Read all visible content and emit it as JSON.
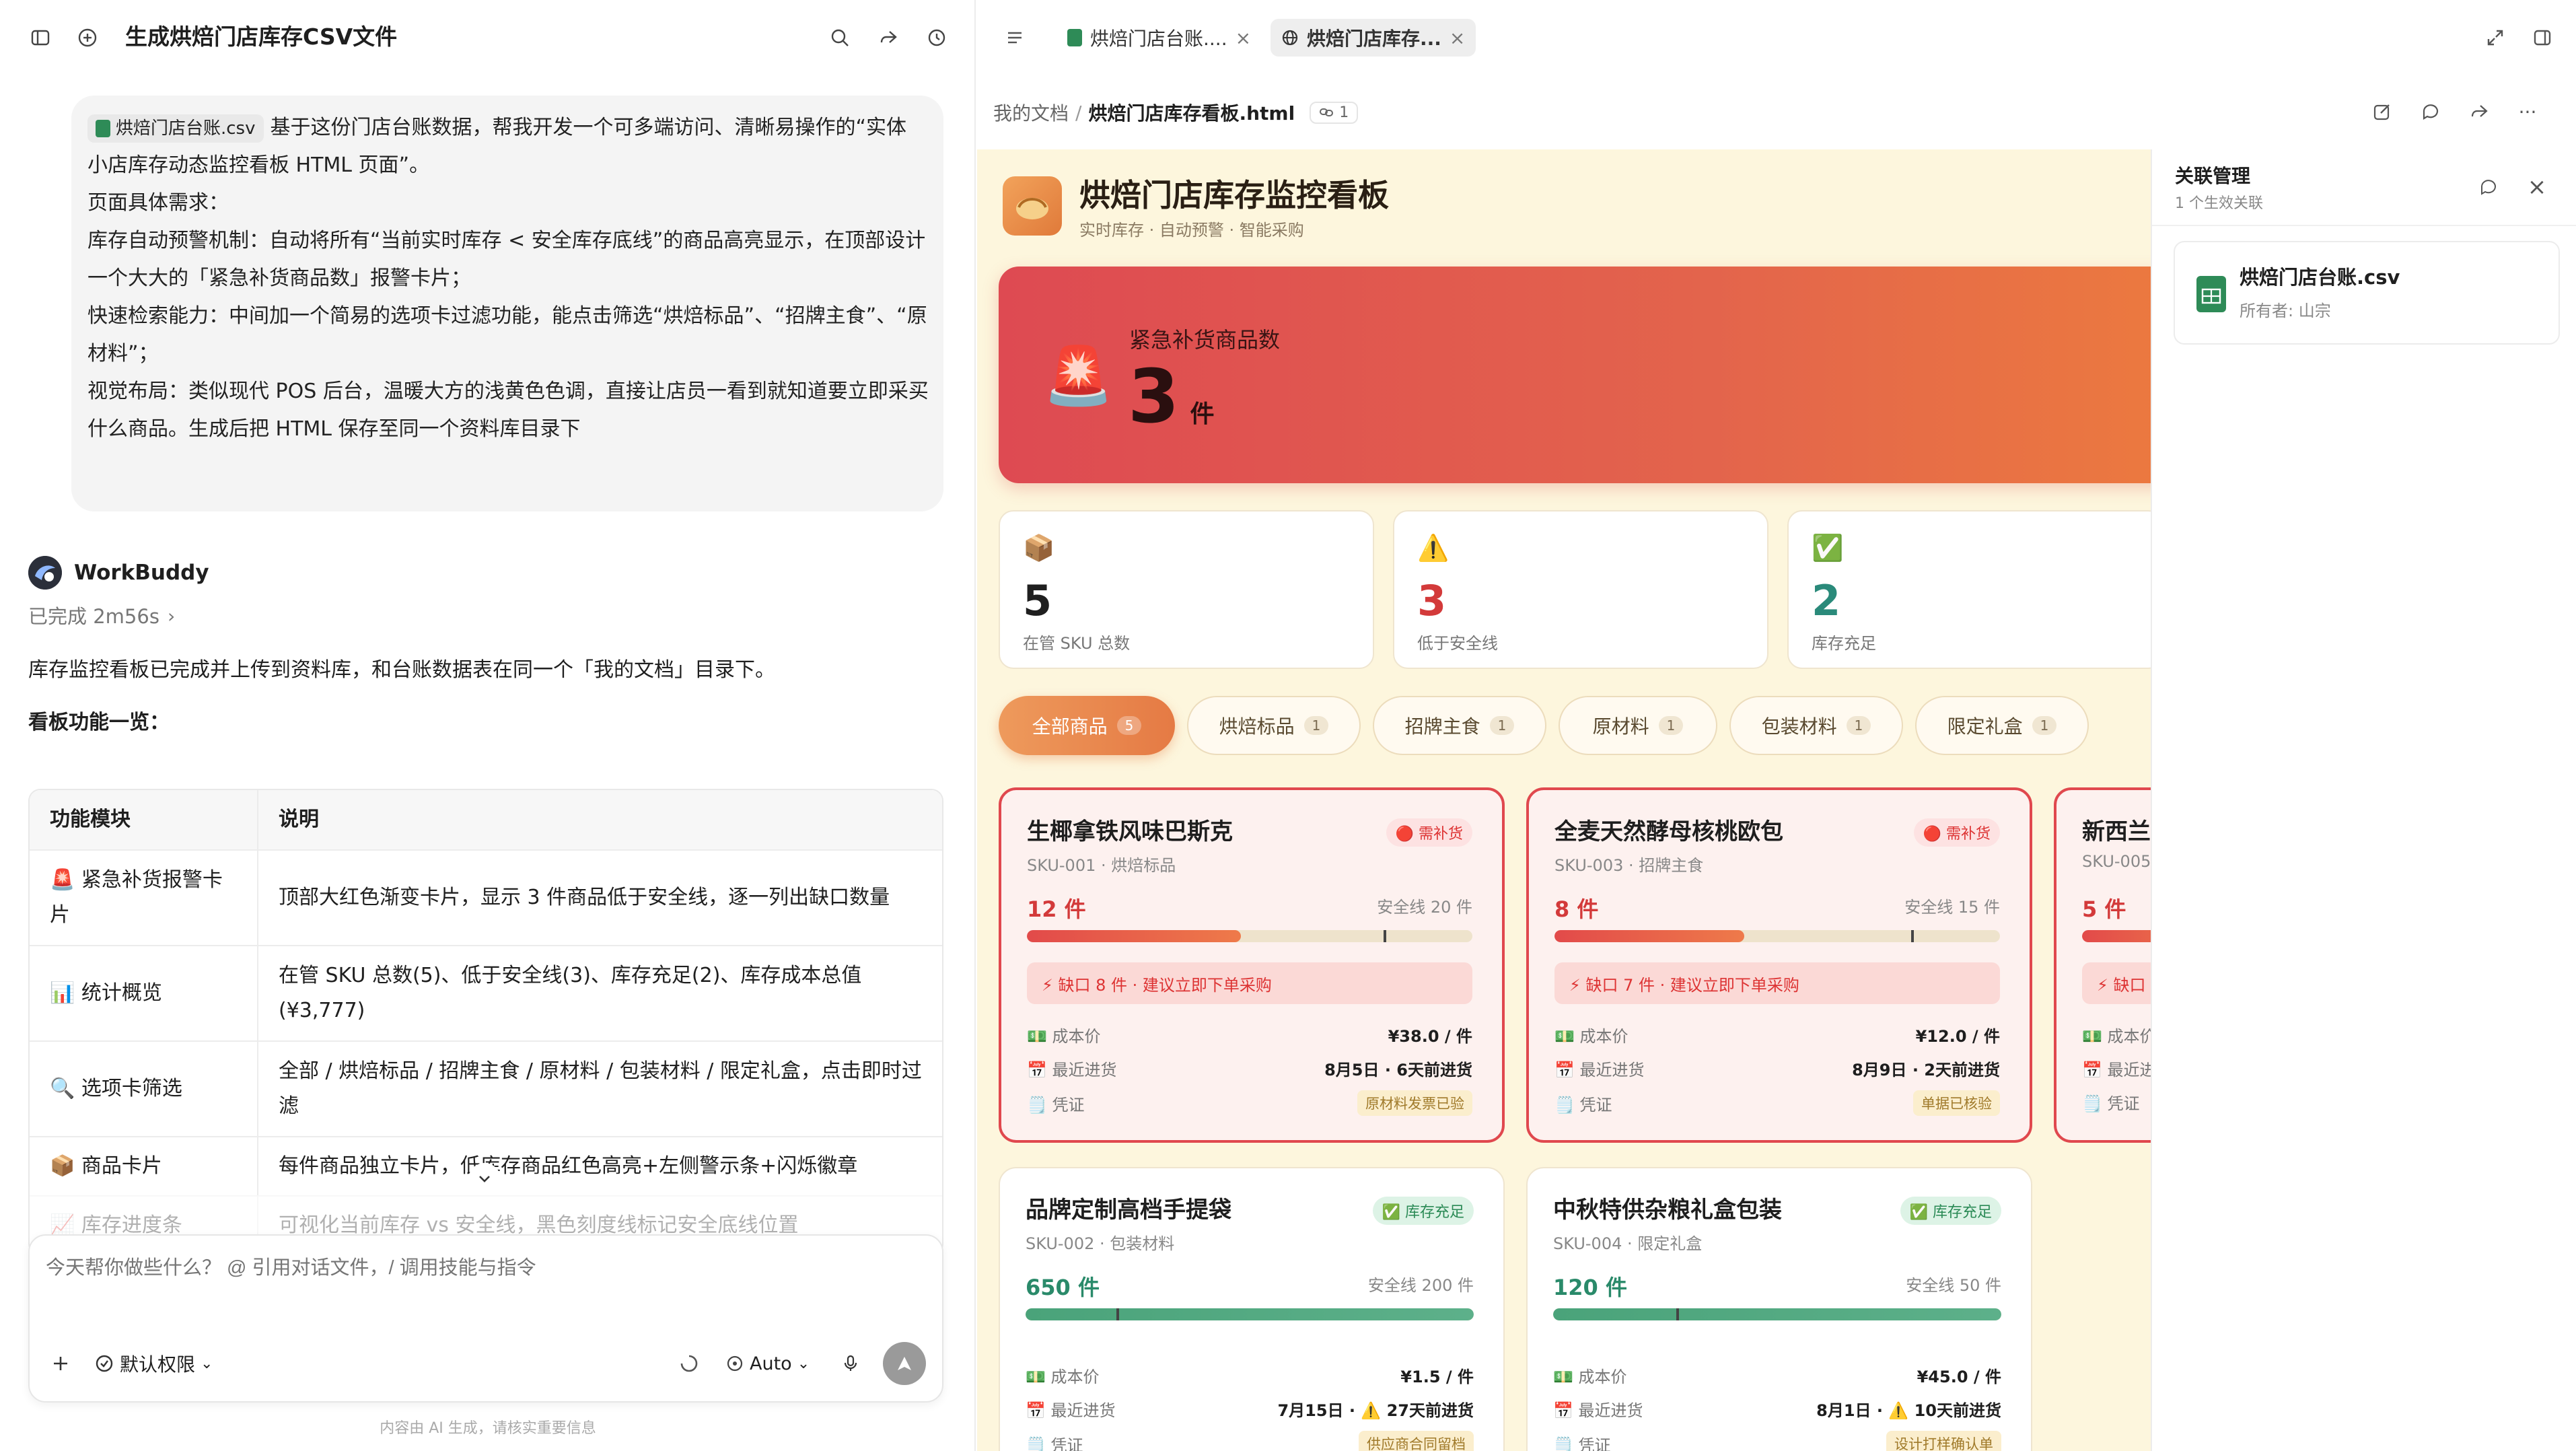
{
  "left": {
    "title": "生成烘焙门店库存CSV文件",
    "user_message": {
      "file_chip": "烘焙门店台账.csv",
      "lines": [
        "基于这份门店台账数据，帮我开发一个可多端访问、清晰易操作的“实体",
        "小店库存动态监控看板 HTML 页面”。",
        "页面具体需求：",
        "库存自动预警机制：自动将所有“当前实时库存 < 安全库存底线”的商品高亮显示，在顶部设计",
        "一个大大的「紧急补货商品数」报警卡片；",
        "",
        "快速检索能力：中间加一个简易的选项卡过滤功能，能点击筛选“烘焙标品”、“招牌主食”、“原",
        "材料”；",
        "",
        "视觉布局：类似现代 POS 后台，温暖大方的浅黄色色调，直接让店员一看到就知道要立即采买",
        "什么商品。生成后把 HTML 保存至同一个资料库目录下"
      ]
    },
    "assistant": {
      "name": "WorkBuddy",
      "status": "已完成 2m56s",
      "intro": "库存监控看板已完成并上传到资料库，和台账数据表在同一个「我的文档」目录下。",
      "heading": "看板功能一览：",
      "table": {
        "headers": [
          "功能模块",
          "说明"
        ],
        "rows": [
          [
            "🚨 紧急补货报警卡片",
            "顶部大红色渐变卡片，显示 3 件商品低于安全线，逐一列出缺口数量"
          ],
          [
            "📊 统计概览",
            "在管 SKU 总数(5)、低于安全线(3)、库存充足(2)、库存成本总值(¥3,777)"
          ],
          [
            "🔍 选项卡筛选",
            "全部 / 烘焙标品 / 招牌主食 / 原材料 / 包装材料 / 限定礼盒，点击即时过滤"
          ],
          [
            "📦 商品卡片",
            "每件商品独立卡片，低库存商品红色高亮+左侧警示条+闪烁徽章"
          ],
          [
            "📈 库存进度条",
            "可视化当前库存 vs 安全线，黑色刻度线标记安全底线位置"
          ]
        ]
      }
    },
    "composer": {
      "placeholder": "今天帮你做些什么？ @ 引用对话文件，/ 调用技能与指令",
      "permission": "默认权限",
      "model": "Auto",
      "disclaimer": "内容由 AI 生成，请核实重要信息"
    }
  },
  "right": {
    "tabs": [
      {
        "label": "烘焙门店台账...."
      },
      {
        "label": "烘焙门店库存..."
      }
    ],
    "breadcrumb": {
      "root": "我的文档",
      "sep": "/",
      "file": "烘焙门店库存看板.html",
      "count": "1"
    },
    "board": {
      "title": "烘焙门店库存监控看板",
      "subtitle": "实时库存 · 自动预警 · 智能采购",
      "alert": {
        "label": "紧急补货商品数",
        "value": "3",
        "unit": "件"
      },
      "kpis": [
        {
          "emoji": "📦",
          "value": "5",
          "label": "在管 SKU 总数",
          "color": "#1f1f1f"
        },
        {
          "emoji": "⚠️",
          "value": "3",
          "label": "低于安全线",
          "color": "#d33a3a"
        },
        {
          "emoji": "✅",
          "value": "2",
          "label": "库存充足",
          "color": "#2a8a7a"
        }
      ],
      "filters": [
        {
          "label": "全部商品",
          "count": "5"
        },
        {
          "label": "烘焙标品",
          "count": "1"
        },
        {
          "label": "招牌主食",
          "count": "1"
        },
        {
          "label": "原材料",
          "count": "1"
        },
        {
          "label": "包装材料",
          "count": "1"
        },
        {
          "label": "限定礼盒",
          "count": "1"
        }
      ],
      "row_labels": {
        "cost": "成本价",
        "last": "最近进货",
        "voucher": "凭证"
      },
      "products": [
        {
          "name": "生椰拿铁风味巴斯克",
          "sku": "SKU-001",
          "category": "烘焙标品",
          "badge": "🔴 需补货",
          "qty": "12 件",
          "safe": "安全线 20 件",
          "stock": 12,
          "safe_level": 20,
          "warn": "⚡ 缺口 8 件 · 建议立即下单采购",
          "cost": "¥38.0 / 件",
          "last": "8月5日 · 6天前进货",
          "voucher": "原材料发票已验"
        },
        {
          "name": "全麦天然酵母核桃欧包",
          "sku": "SKU-003",
          "category": "招牌主食",
          "badge": "🔴 需补货",
          "qty": "8 件",
          "safe": "安全线 15 件",
          "stock": 8,
          "safe_level": 15,
          "warn": "⚡ 缺口 7 件 · 建议立即下单采购",
          "cost": "¥12.0 / 件",
          "last": "8月9日 · 2天前进货",
          "voucher": "单据已核验"
        },
        {
          "name": "新西兰",
          "sku": "SKU-005",
          "category": "",
          "badge": "",
          "qty": "5 件",
          "safe": "",
          "warn": "⚡ 缺口",
          "cost": "",
          "last": "",
          "voucher": ""
        },
        {
          "name": "品牌定制高档手提袋",
          "sku": "SKU-002",
          "category": "包装材料",
          "badge": "✅ 库存充足",
          "qty": "650 件",
          "safe": "安全线 200 件",
          "stock": 650,
          "safe_level": 200,
          "cost": "¥1.5 / 件",
          "last": "7月15日 · ⚠️ 27天前进货",
          "voucher": "供应商合同留档"
        },
        {
          "name": "中秋特供杂粮礼盒包装",
          "sku": "SKU-004",
          "category": "限定礼盒",
          "badge": "✅ 库存充足",
          "qty": "120 件",
          "safe": "安全线 50 件",
          "stock": 120,
          "safe_level": 50,
          "cost": "¥45.0 / 件",
          "last": "8月1日 · ⚠️ 10天前进货",
          "voucher": "设计打样确认单"
        }
      ]
    },
    "side_panel": {
      "title": "关联管理",
      "subtitle": "1 个生效关联",
      "file_name": "烘焙门店台账.csv",
      "owner": "所有者: 山宗"
    }
  }
}
